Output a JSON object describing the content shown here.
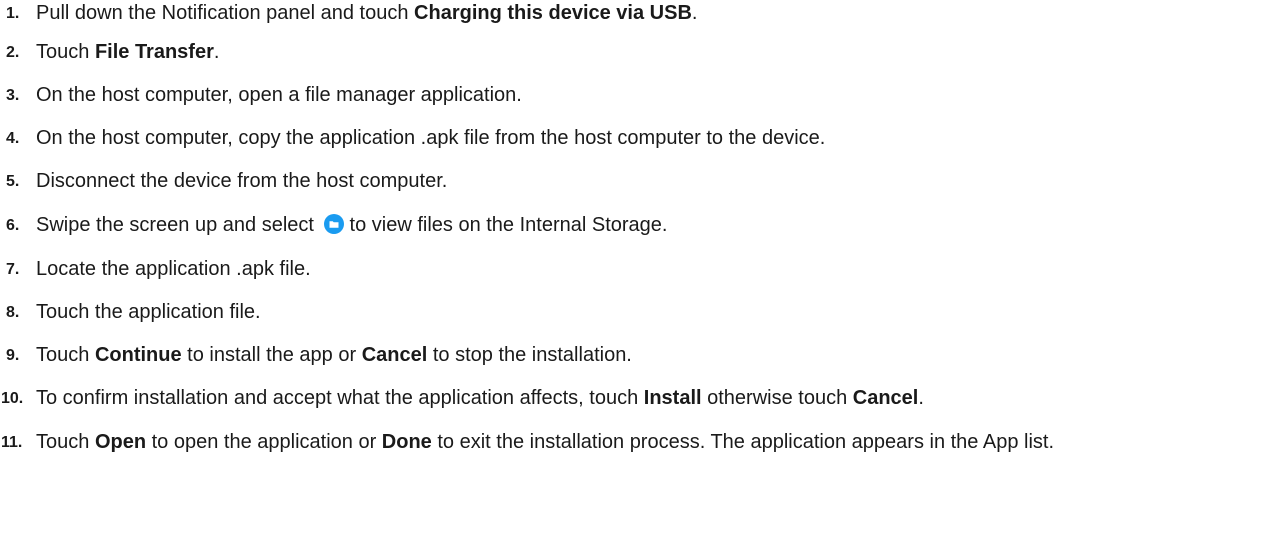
{
  "steps": [
    {
      "number": "1.",
      "parts": [
        "Pull down the Notification panel and touch ",
        "Charging this device via USB",
        "."
      ]
    },
    {
      "number": "2.",
      "parts": [
        "Touch ",
        "File Transfer",
        "."
      ]
    },
    {
      "number": "3.",
      "parts": [
        "On the host computer, open a file manager application."
      ]
    },
    {
      "number": "4.",
      "parts": [
        "On the host computer, copy the application .apk file from the host computer to the device."
      ]
    },
    {
      "number": "5.",
      "parts": [
        "Disconnect the device from the host computer."
      ]
    },
    {
      "number": "6.",
      "parts": [
        "Swipe the screen up and select ",
        "to view files on the Internal Storage."
      ],
      "icon": "folder-icon"
    },
    {
      "number": "7.",
      "parts": [
        "Locate the application .apk file."
      ]
    },
    {
      "number": "8.",
      "parts": [
        "Touch the application file."
      ]
    },
    {
      "number": "9.",
      "parts": [
        "Touch ",
        "Continue",
        " to install the app or ",
        "Cancel",
        " to stop the installation."
      ]
    },
    {
      "number": "10.",
      "parts": [
        "To confirm installation and accept what the application affects, touch ",
        "Install",
        " otherwise touch ",
        "Cancel",
        "."
      ]
    },
    {
      "number": "11.",
      "parts": [
        "Touch ",
        "Open",
        " to open the application or ",
        "Done",
        " to exit the installation process. The application appears in the App list."
      ]
    }
  ],
  "colors": {
    "text": "#1a1a1a",
    "folder_icon": "#1a9bf0"
  }
}
